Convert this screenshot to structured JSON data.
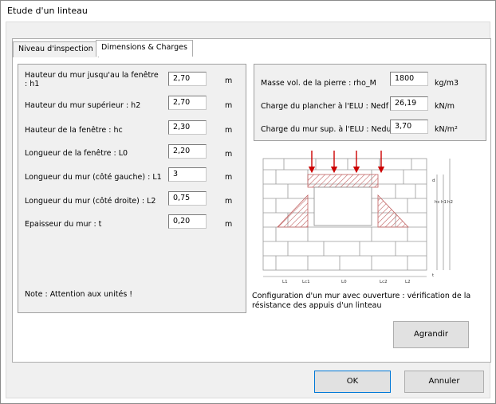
{
  "window": {
    "title": "Etude d'un linteau"
  },
  "tabs": [
    {
      "label": "Niveau d'inspection",
      "active": false
    },
    {
      "label": "Dimensions & Charges",
      "active": true
    }
  ],
  "dimensions": [
    {
      "label": "Hauteur du mur jusqu'au la fenêtre : h1",
      "value": "2,70",
      "unit": "m"
    },
    {
      "label": "Hauteur du mur supérieur : h2",
      "value": "2,70",
      "unit": "m"
    },
    {
      "label": "Hauteur de la fenêtre : hc",
      "value": "2,30",
      "unit": "m"
    },
    {
      "label": "Longueur de la fenêtre : L0",
      "value": "2,20",
      "unit": "m"
    },
    {
      "label": "Longueur du mur (côté gauche) : L1",
      "value": "3",
      "unit": "m"
    },
    {
      "label": "Longueur du mur (côté droite) : L2",
      "value": "0,75",
      "unit": "m"
    },
    {
      "label": "Epaisseur du mur : t",
      "value": "0,20",
      "unit": "m"
    }
  ],
  "note": "Note : Attention aux unités !",
  "charges": [
    {
      "label": "Masse vol. de la pierre : rho_M",
      "value": "1800",
      "unit": "kg/m3"
    },
    {
      "label": "Charge du plancher à l'ELU : Nedf",
      "value": "26,19",
      "unit": "kN/m"
    },
    {
      "label": "Charge du mur sup. à l'ELU : Nedu",
      "value": "3,70",
      "unit": "kN/m²"
    }
  ],
  "diagram": {
    "bottom_labels": [
      "L1",
      "Lc1",
      "L0",
      "Lc2",
      "L2"
    ],
    "right_labels": [
      "d",
      "hc",
      "h1",
      "h2",
      "t"
    ],
    "caption": "Configuration d'un mur avec ouverture : vérification de la résistance des appuis d'un linteau",
    "arrow_color": "#cc0000",
    "hatch_color": "#c06060"
  },
  "buttons": {
    "agrandir": "Agrandir",
    "ok": "OK",
    "annuler": "Annuler"
  }
}
